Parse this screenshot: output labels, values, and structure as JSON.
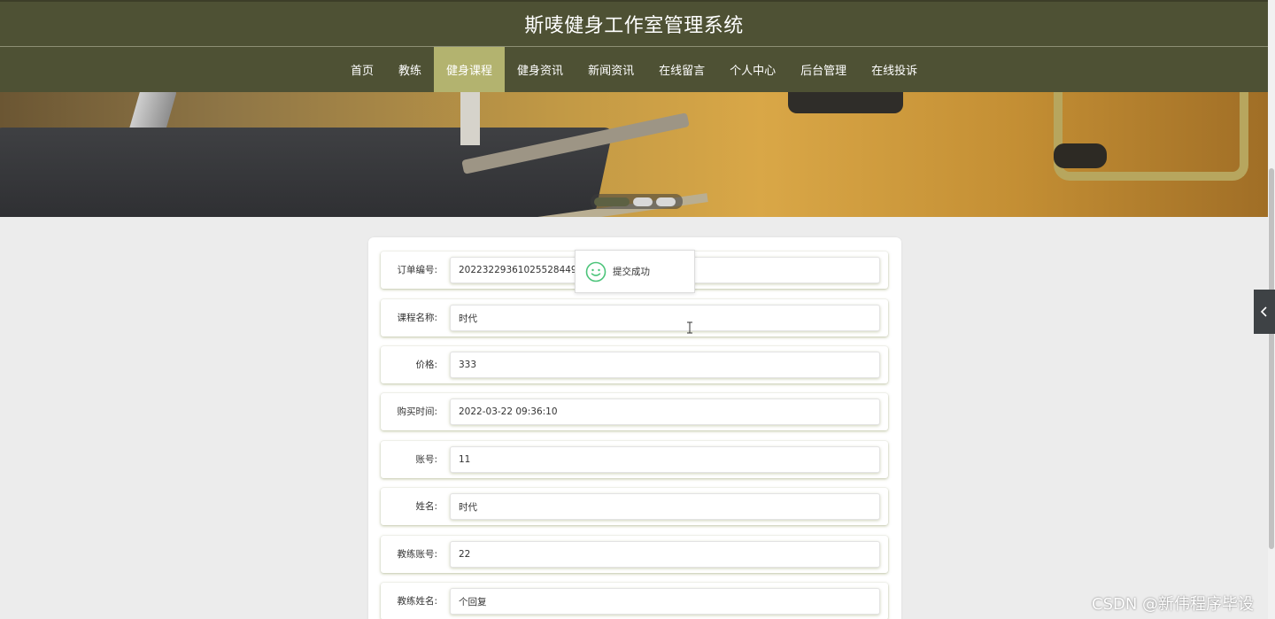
{
  "header": {
    "title": "斯唛健身工作室管理系统"
  },
  "nav": {
    "items": [
      {
        "label": "首页",
        "active": false
      },
      {
        "label": "教练",
        "active": false
      },
      {
        "label": "健身课程",
        "active": true
      },
      {
        "label": "健身资讯",
        "active": false
      },
      {
        "label": "新闻资讯",
        "active": false
      },
      {
        "label": "在线留言",
        "active": false
      },
      {
        "label": "个人中心",
        "active": false
      },
      {
        "label": "后台管理",
        "active": false
      },
      {
        "label": "在线投诉",
        "active": false
      }
    ]
  },
  "banner": {
    "slides_total": 3,
    "active_slide": 1
  },
  "form": {
    "fields": [
      {
        "label": "订单编号:",
        "value": "20223229361025528449"
      },
      {
        "label": "课程名称:",
        "value": "时代"
      },
      {
        "label": "价格:",
        "value": "333"
      },
      {
        "label": "购买时间:",
        "value": "2022-03-22 09:36:10"
      },
      {
        "label": "账号:",
        "value": "11"
      },
      {
        "label": "姓名:",
        "value": "时代"
      },
      {
        "label": "教练账号:",
        "value": "22"
      },
      {
        "label": "教练姓名:",
        "value": "个回复"
      }
    ]
  },
  "toast": {
    "message": "提交成功",
    "icon": "smile-icon",
    "icon_color": "#4cc47a"
  },
  "side_toggle": {
    "icon": "chevron-left-icon"
  },
  "watermark": {
    "text": "CSDN @新伟程序毕设"
  },
  "colors": {
    "header_bg": "#4e5134",
    "nav_active_bg": "#b3b36f",
    "page_bg": "#ececec"
  }
}
